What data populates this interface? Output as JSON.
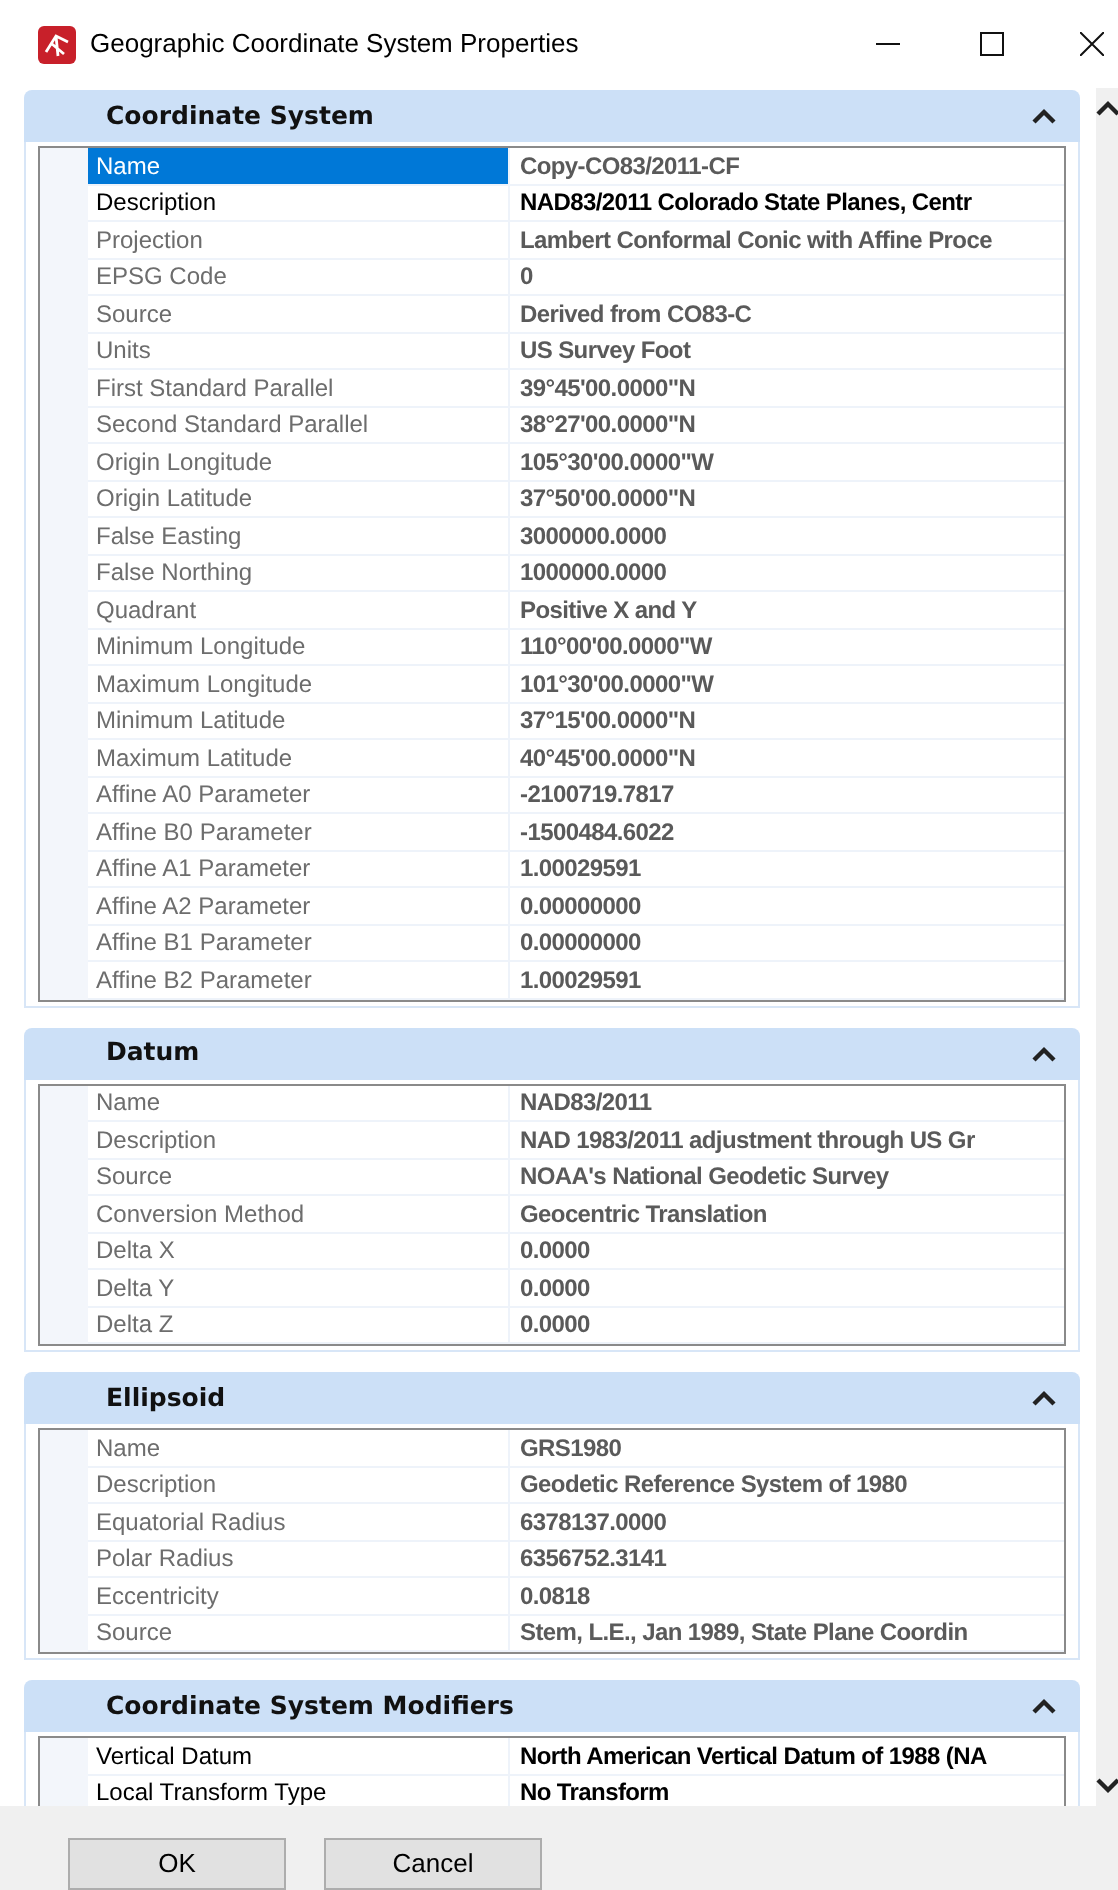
{
  "window": {
    "title": "Geographic Coordinate System Properties"
  },
  "sections": [
    {
      "title": "Coordinate System",
      "expanded": true,
      "rows": [
        {
          "label": "Name",
          "value": "Copy-CO83/2011-CF",
          "editable": false,
          "selected": true
        },
        {
          "label": "Description",
          "value": "NAD83/2011 Colorado State Planes, Centr",
          "editable": true,
          "selected": false
        },
        {
          "label": "Projection",
          "value": "Lambert Conformal Conic with Affine Proce",
          "editable": false,
          "selected": false
        },
        {
          "label": "EPSG Code",
          "value": "0",
          "editable": false,
          "selected": false
        },
        {
          "label": "Source",
          "value": "Derived from CO83-C",
          "editable": false,
          "selected": false
        },
        {
          "label": "Units",
          "value": "US Survey Foot",
          "editable": false,
          "selected": false
        },
        {
          "label": "First Standard Parallel",
          "value": "39°45'00.0000\"N",
          "editable": false,
          "selected": false
        },
        {
          "label": "Second Standard Parallel",
          "value": "38°27'00.0000\"N",
          "editable": false,
          "selected": false
        },
        {
          "label": "Origin Longitude",
          "value": "105°30'00.0000\"W",
          "editable": false,
          "selected": false
        },
        {
          "label": "Origin Latitude",
          "value": "37°50'00.0000\"N",
          "editable": false,
          "selected": false
        },
        {
          "label": "False Easting",
          "value": "3000000.0000",
          "editable": false,
          "selected": false
        },
        {
          "label": "False Northing",
          "value": "1000000.0000",
          "editable": false,
          "selected": false
        },
        {
          "label": "Quadrant",
          "value": "Positive X and Y",
          "editable": false,
          "selected": false
        },
        {
          "label": "Minimum Longitude",
          "value": "110°00'00.0000\"W",
          "editable": false,
          "selected": false
        },
        {
          "label": "Maximum Longitude",
          "value": "101°30'00.0000\"W",
          "editable": false,
          "selected": false
        },
        {
          "label": "Minimum Latitude",
          "value": "37°15'00.0000\"N",
          "editable": false,
          "selected": false
        },
        {
          "label": "Maximum Latitude",
          "value": "40°45'00.0000\"N",
          "editable": false,
          "selected": false
        },
        {
          "label": "Affine A0 Parameter",
          "value": "-2100719.7817",
          "editable": false,
          "selected": false
        },
        {
          "label": "Affine B0 Parameter",
          "value": "-1500484.6022",
          "editable": false,
          "selected": false
        },
        {
          "label": "Affine A1 Parameter",
          "value": "1.00029591",
          "editable": false,
          "selected": false
        },
        {
          "label": "Affine A2 Parameter",
          "value": "0.00000000",
          "editable": false,
          "selected": false
        },
        {
          "label": "Affine B1 Parameter",
          "value": "0.00000000",
          "editable": false,
          "selected": false
        },
        {
          "label": "Affine B2 Parameter",
          "value": "1.00029591",
          "editable": false,
          "selected": false
        }
      ]
    },
    {
      "title": "Datum",
      "expanded": true,
      "rows": [
        {
          "label": "Name",
          "value": "NAD83/2011",
          "editable": false,
          "selected": false
        },
        {
          "label": "Description",
          "value": "NAD 1983/2011 adjustment through US Gr",
          "editable": false,
          "selected": false
        },
        {
          "label": "Source",
          "value": "NOAA's National Geodetic Survey",
          "editable": false,
          "selected": false
        },
        {
          "label": "Conversion Method",
          "value": "Geocentric Translation",
          "editable": false,
          "selected": false
        },
        {
          "label": "Delta X",
          "value": "0.0000",
          "editable": false,
          "selected": false
        },
        {
          "label": "Delta Y",
          "value": "0.0000",
          "editable": false,
          "selected": false
        },
        {
          "label": "Delta Z",
          "value": "0.0000",
          "editable": false,
          "selected": false
        }
      ]
    },
    {
      "title": "Ellipsoid",
      "expanded": true,
      "rows": [
        {
          "label": "Name",
          "value": "GRS1980",
          "editable": false,
          "selected": false
        },
        {
          "label": "Description",
          "value": "Geodetic Reference System of 1980",
          "editable": false,
          "selected": false
        },
        {
          "label": "Equatorial Radius",
          "value": "6378137.0000",
          "editable": false,
          "selected": false
        },
        {
          "label": "Polar Radius",
          "value": "6356752.3141",
          "editable": false,
          "selected": false
        },
        {
          "label": "Eccentricity",
          "value": "0.0818",
          "editable": false,
          "selected": false
        },
        {
          "label": "Source",
          "value": "Stem, L.E., Jan 1989, State Plane Coordin",
          "editable": false,
          "selected": false
        }
      ]
    },
    {
      "title": "Coordinate System Modifiers",
      "expanded": true,
      "rows": [
        {
          "label": "Vertical Datum",
          "value": "North American Vertical Datum of 1988 (NA",
          "editable": true,
          "selected": false
        },
        {
          "label": "Local Transform Type",
          "value": "No Transform",
          "editable": true,
          "selected": false
        }
      ]
    }
  ],
  "buttons": [
    "OK",
    "Cancel"
  ]
}
